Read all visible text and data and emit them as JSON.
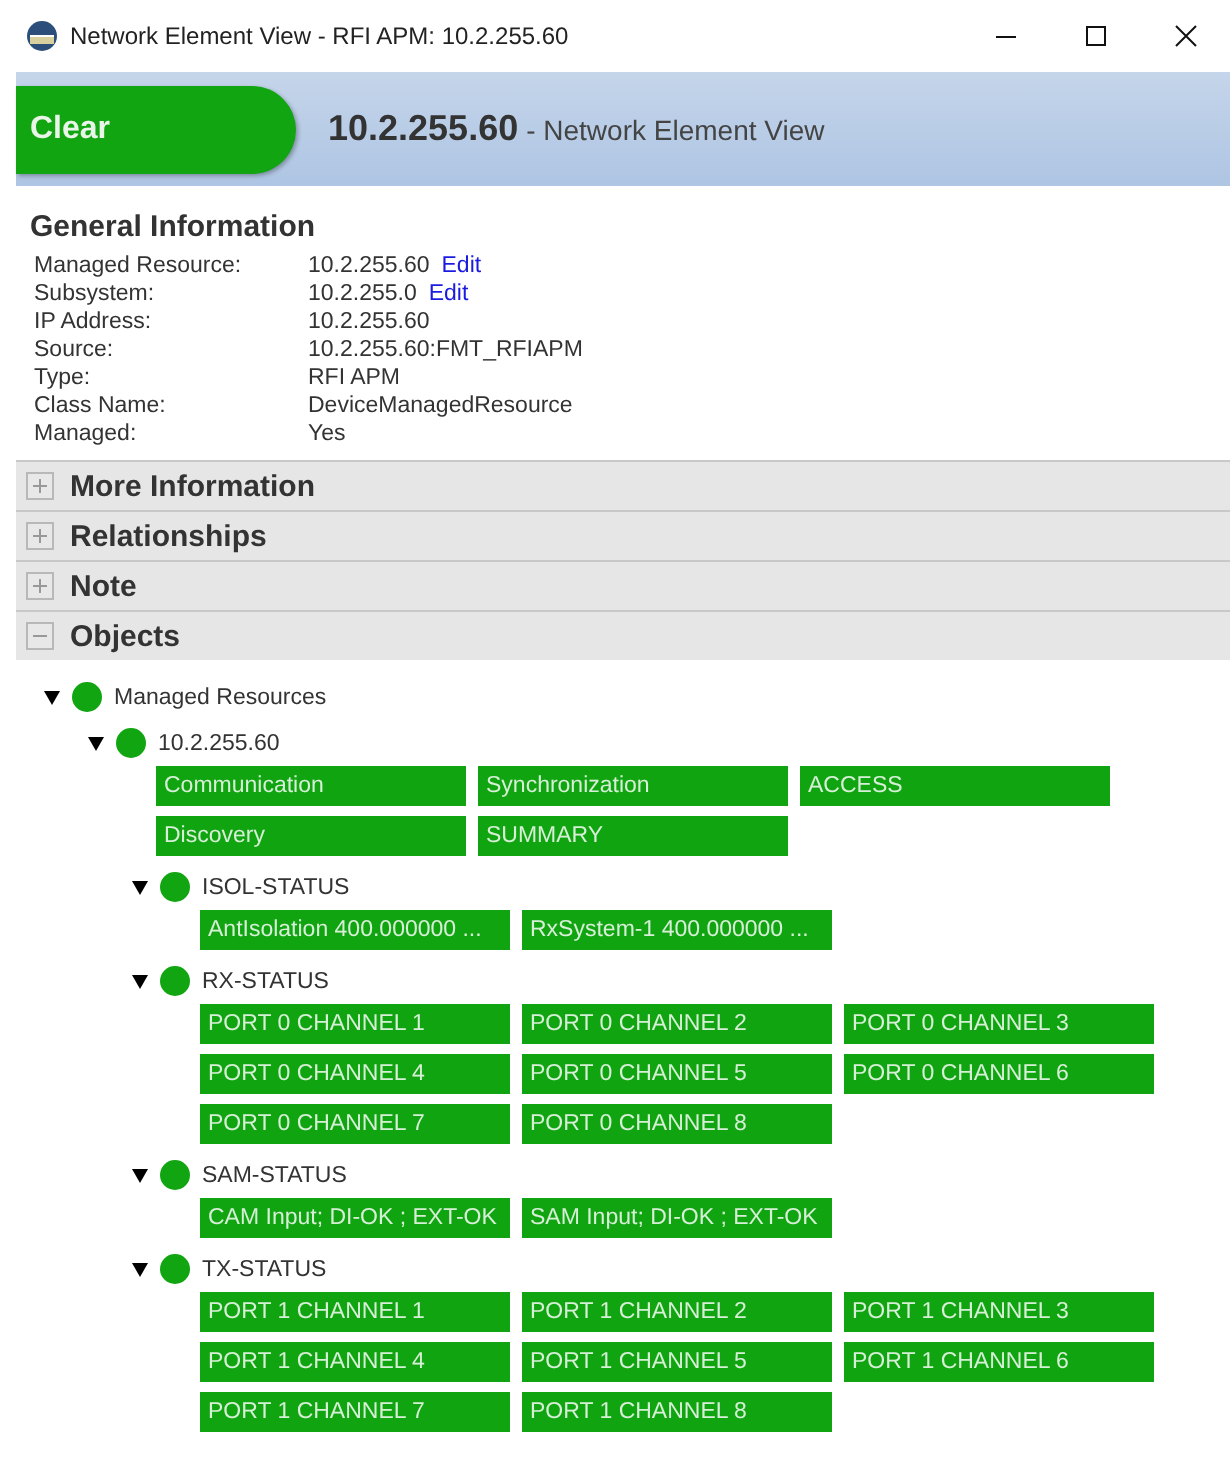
{
  "window": {
    "title": "Network Element View - RFI APM: 10.2.255.60"
  },
  "header": {
    "status": "Clear",
    "color": "#11a611",
    "name": "10.2.255.60",
    "subtitle": "- Network Element View"
  },
  "general_information": {
    "title": "General Information",
    "fields": [
      {
        "label": "Managed Resource:",
        "value": "10.2.255.60",
        "link": "Edit"
      },
      {
        "label": "Subsystem:",
        "value": "10.2.255.0",
        "link": "Edit"
      },
      {
        "label": "IP Address:",
        "value": "10.2.255.60"
      },
      {
        "label": "Source:",
        "value": "10.2.255.60:FMT_RFIAPM"
      },
      {
        "label": "Type:",
        "value": "RFI APM"
      },
      {
        "label": "Class Name:",
        "value": "DeviceManagedResource"
      },
      {
        "label": "Managed:",
        "value": "Yes"
      }
    ]
  },
  "sections": [
    {
      "title": "More Information",
      "expanded": false
    },
    {
      "title": "Relationships",
      "expanded": false
    },
    {
      "title": "Note",
      "expanded": false
    },
    {
      "title": "Objects",
      "expanded": true
    }
  ],
  "tree": [
    {
      "label": "Managed Resources",
      "expanded": true,
      "color": "#11a611",
      "children": [
        {
          "label": "10.2.255.60",
          "expanded": true,
          "color": "#11a611",
          "tiles": [
            "Communication",
            "Synchronization",
            "ACCESS",
            "Discovery",
            "SUMMARY"
          ],
          "children": [
            {
              "label": "ISOL-STATUS",
              "expanded": true,
              "color": "#11a611",
              "tiles": [
                "AntIsolation 400.000000 ...",
                "RxSystem-1 400.000000 ..."
              ]
            },
            {
              "label": "RX-STATUS",
              "expanded": true,
              "color": "#11a611",
              "tiles": [
                "PORT 0 CHANNEL 1",
                "PORT 0 CHANNEL 2",
                "PORT 0 CHANNEL 3",
                "PORT 0 CHANNEL 4",
                "PORT 0 CHANNEL 5",
                "PORT 0 CHANNEL 6",
                "PORT 0 CHANNEL 7",
                "PORT 0 CHANNEL 8"
              ]
            },
            {
              "label": "SAM-STATUS",
              "expanded": true,
              "color": "#11a611",
              "tiles": [
                "CAM Input; DI-OK ; EXT-OK",
                "SAM Input; DI-OK ; EXT-OK"
              ]
            },
            {
              "label": "TX-STATUS",
              "expanded": true,
              "color": "#11a611",
              "tiles": [
                "PORT 1 CHANNEL 1",
                "PORT 1 CHANNEL 2",
                "PORT 1 CHANNEL 3",
                "PORT 1 CHANNEL 4",
                "PORT 1 CHANNEL 5",
                "PORT 1 CHANNEL 6",
                "PORT 1 CHANNEL 7",
                "PORT 1 CHANNEL 8"
              ]
            }
          ]
        }
      ]
    }
  ]
}
